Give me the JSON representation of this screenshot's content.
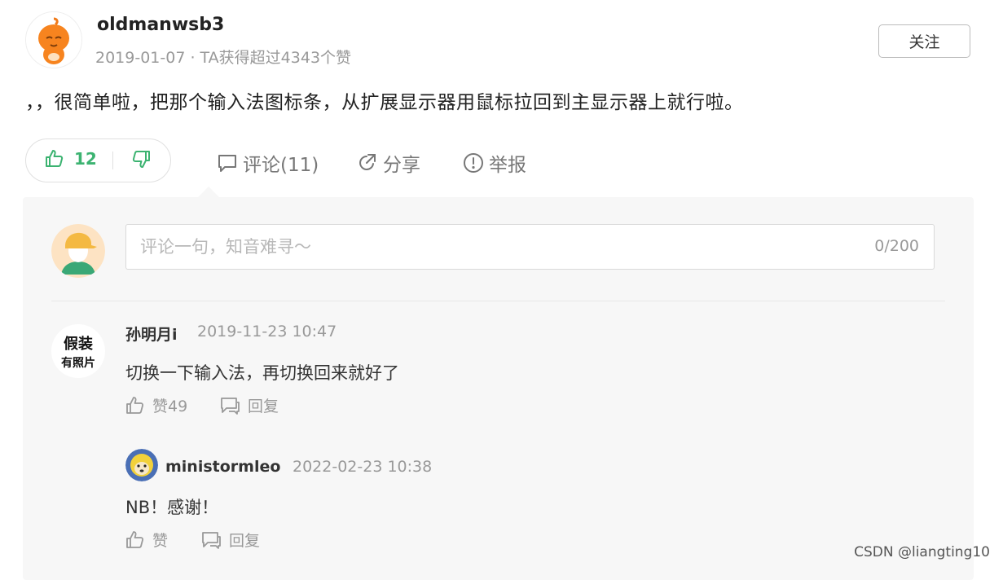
{
  "post": {
    "author": "oldmanwsb3",
    "date": "2019-01-07",
    "meta_separator": " · ",
    "likes_received": "TA获得超过4343个赞",
    "follow_label": "关注",
    "content": "，，很简单啦，把那个输入法图标条，从扩展显示器用鼠标拉回到主显示器上就行啦。"
  },
  "actions": {
    "upvote_count": "12",
    "comment_label": "评论(11)",
    "share_label": "分享",
    "report_label": "举报"
  },
  "comment_box": {
    "placeholder": "评论一句，知音难寻～",
    "char_count": "0/200"
  },
  "comments": [
    {
      "author": "孙明月i",
      "time": "2019-11-23 10:47",
      "text": "切换一下输入法，再切换回来就好了",
      "like_label": "赞49",
      "reply_label": "回复",
      "avatar_text": [
        "假装",
        "有照片"
      ]
    },
    {
      "author": "ministormleo",
      "time": "2022-02-23 10:38",
      "text": "NB！感谢！",
      "like_label": "赞",
      "reply_label": "回复"
    }
  ],
  "watermark": "CSDN @liangting10",
  "icons": {
    "upvote": "thumbs-up-icon",
    "downvote": "thumbs-down-icon",
    "comment": "comment-bubble-icon",
    "share": "share-icon",
    "report": "alert-circle-icon"
  },
  "colors": {
    "accent_green": "#3cb371",
    "muted_text": "#999999",
    "panel_bg": "#f7f7f7"
  }
}
